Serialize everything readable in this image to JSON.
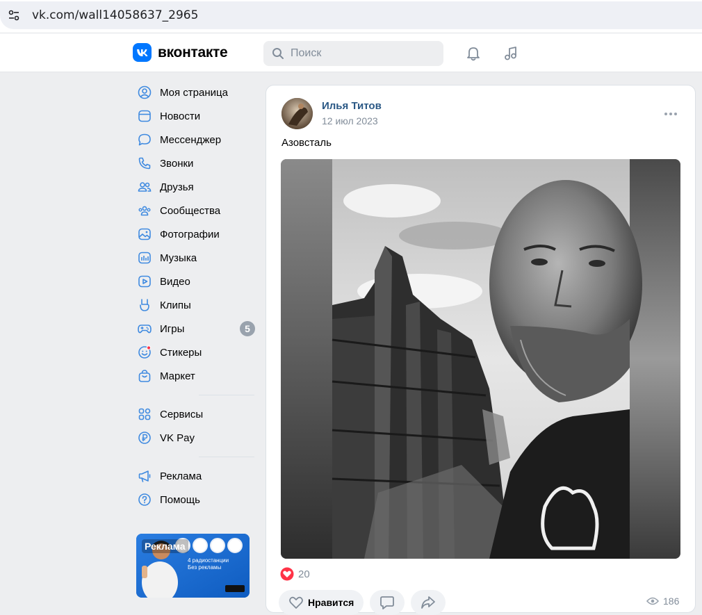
{
  "browser": {
    "url": "vk.com/wall14058637_2965"
  },
  "header": {
    "logo_text": "вконтакте",
    "search_placeholder": "Поиск"
  },
  "sidebar": {
    "items": [
      {
        "label": "Моя страница",
        "icon": "user-circle-icon"
      },
      {
        "label": "Новости",
        "icon": "news-icon"
      },
      {
        "label": "Мессенджер",
        "icon": "message-icon"
      },
      {
        "label": "Звонки",
        "icon": "phone-icon"
      },
      {
        "label": "Друзья",
        "icon": "friends-icon"
      },
      {
        "label": "Сообщества",
        "icon": "communities-icon"
      },
      {
        "label": "Фотографии",
        "icon": "photo-icon"
      },
      {
        "label": "Музыка",
        "icon": "music-icon"
      },
      {
        "label": "Видео",
        "icon": "video-icon"
      },
      {
        "label": "Клипы",
        "icon": "clips-icon"
      },
      {
        "label": "Игры",
        "icon": "games-icon",
        "badge": "5"
      },
      {
        "label": "Стикеры",
        "icon": "stickers-icon"
      },
      {
        "label": "Маркет",
        "icon": "market-icon"
      }
    ],
    "secondary": [
      {
        "label": "Сервисы",
        "icon": "services-icon"
      },
      {
        "label": "VK Pay",
        "icon": "vkpay-icon"
      }
    ],
    "tertiary": [
      {
        "label": "Реклама",
        "icon": "megaphone-icon"
      },
      {
        "label": "Помощь",
        "icon": "help-icon"
      }
    ],
    "ad": {
      "label": "Реклама",
      "text_line1": "4 радиостанции",
      "text_line2": "Без рекламы"
    }
  },
  "post": {
    "author": "Илья Титов",
    "date": "12 июл 2023",
    "text": "Азовсталь",
    "likes": "20",
    "like_label": "Нравится",
    "views": "186"
  },
  "colors": {
    "accent": "#0077ff",
    "link": "#2a5885",
    "icon": "#3f8ae0",
    "muted": "#818c99",
    "like": "#ff3347"
  }
}
